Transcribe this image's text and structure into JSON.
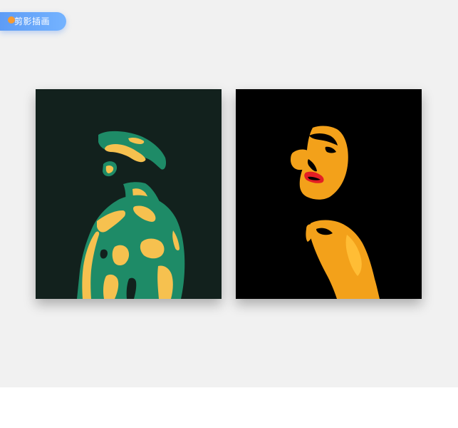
{
  "tag": {
    "label": "剪影插画"
  },
  "colors": {
    "background": "#f1f1f1",
    "tag_gradient_start": "#5d9cf6",
    "tag_gradient_end": "#74b3ff",
    "tag_dot": "#f59a31",
    "left_card_bg": "#12211d",
    "left_green": "#1e8b67",
    "left_yellow": "#f6c14f",
    "right_card_bg": "#000000",
    "right_orange": "#f3a11a",
    "right_red": "#e31e24"
  },
  "illustrations": [
    {
      "name": "man-silhouette-illustration",
      "palette": [
        "#12211d",
        "#1e8b67",
        "#f6c14f"
      ]
    },
    {
      "name": "woman-silhouette-illustration",
      "palette": [
        "#000000",
        "#f3a11a",
        "#e31e24"
      ]
    }
  ]
}
